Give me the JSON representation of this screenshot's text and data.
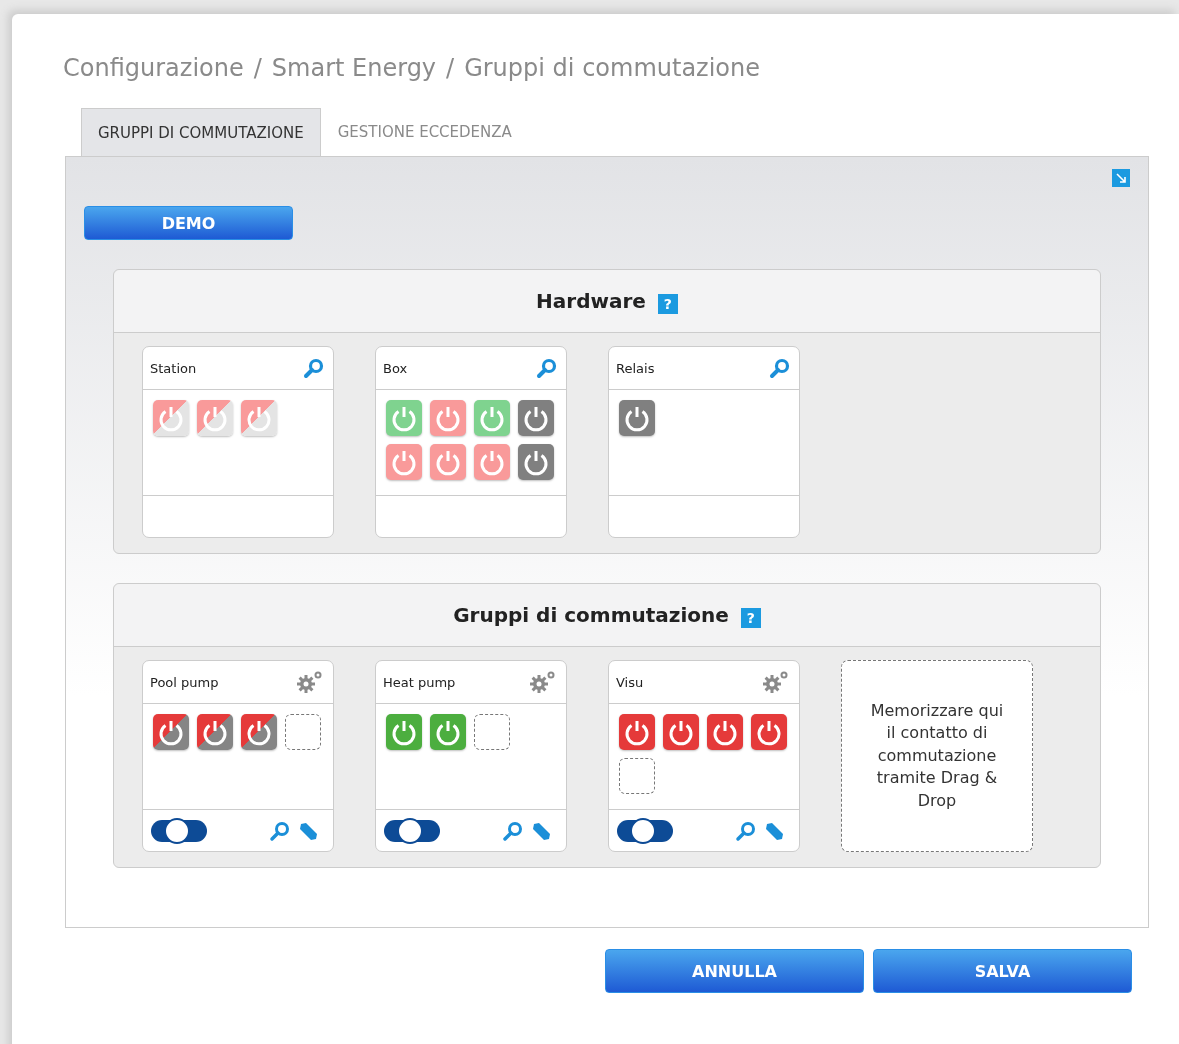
{
  "breadcrumb": [
    "Configurazione",
    "Smart Energy",
    "Gruppi di commutazione"
  ],
  "breadcrumb_separator": "/",
  "tabs": [
    {
      "label": "GRUPPI DI COMMUTAZIONE",
      "selected": true
    },
    {
      "label": "GESTIONE ECCEDENZA",
      "selected": false
    }
  ],
  "demo_button": "DEMO",
  "sections": [
    {
      "title": "Hardware",
      "help": "?",
      "kind": "hardware",
      "cards": [
        {
          "name": "Station",
          "tiles": [
            {
              "kind": "split",
              "color": "#f99a9a",
              "faded": true
            },
            {
              "kind": "split",
              "color": "#f99a9a",
              "faded": true
            },
            {
              "kind": "split",
              "color": "#f99a9a",
              "faded": true
            }
          ]
        },
        {
          "name": "Box",
          "tiles": [
            {
              "kind": "power",
              "color": "#7fd38f"
            },
            {
              "kind": "power",
              "color": "#f99a9a"
            },
            {
              "kind": "power",
              "color": "#7fd38f"
            },
            {
              "kind": "power",
              "color": "#808080"
            },
            {
              "kind": "power",
              "color": "#f99a9a"
            },
            {
              "kind": "power",
              "color": "#f99a9a"
            },
            {
              "kind": "power",
              "color": "#f99a9a"
            },
            {
              "kind": "power",
              "color": "#808080"
            }
          ]
        },
        {
          "name": "Relais",
          "tiles": [
            {
              "kind": "power",
              "color": "#808080"
            }
          ]
        }
      ]
    },
    {
      "title": "Gruppi di commutazione",
      "help": "?",
      "kind": "groups",
      "drop_hint": "Memorizzare qui il contatto di commutazione tramite Drag & Drop",
      "cards": [
        {
          "name": "Pool pump",
          "on": true,
          "tiles": [
            {
              "kind": "split",
              "color": "#e53a3a",
              "faded": false
            },
            {
              "kind": "split",
              "color": "#e53a3a",
              "faded": false
            },
            {
              "kind": "split",
              "color": "#e53a3a",
              "faded": false
            },
            {
              "kind": "empty"
            }
          ]
        },
        {
          "name": "Heat pump",
          "on": true,
          "tiles": [
            {
              "kind": "power",
              "color": "#4cae3f"
            },
            {
              "kind": "power",
              "color": "#4cae3f"
            },
            {
              "kind": "empty"
            }
          ]
        },
        {
          "name": "Visu",
          "on": true,
          "tiles": [
            {
              "kind": "power",
              "color": "#e53a3a"
            },
            {
              "kind": "power",
              "color": "#e53a3a"
            },
            {
              "kind": "power",
              "color": "#e53a3a"
            },
            {
              "kind": "power",
              "color": "#e53a3a"
            },
            {
              "kind": "empty"
            }
          ]
        }
      ]
    }
  ],
  "buttons": [
    "ANNULLA",
    "SALVA"
  ]
}
